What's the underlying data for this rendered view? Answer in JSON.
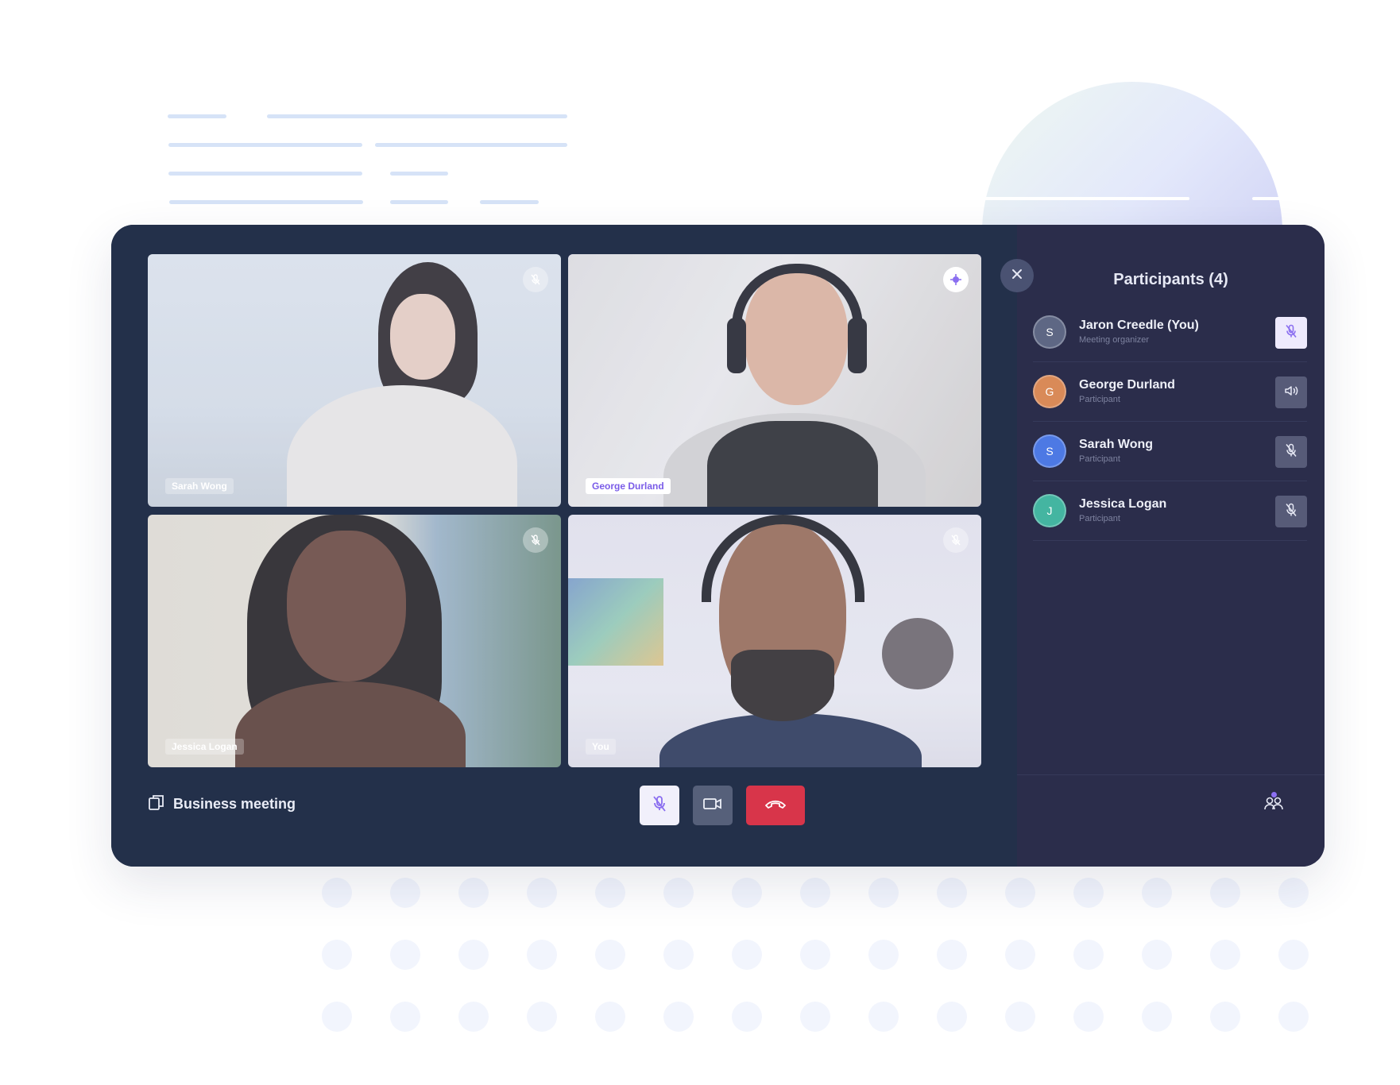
{
  "meeting": {
    "name": "Business meeting",
    "icon": "copy-icon"
  },
  "tiles": [
    {
      "name": "Sarah Wong",
      "mic": "mic-off-icon",
      "active": false
    },
    {
      "name": "George Durland",
      "mic": "speaking-icon",
      "active": true
    },
    {
      "name": "Jessica Logan",
      "mic": "mic-off-icon",
      "active": false
    },
    {
      "name": "You",
      "mic": "mic-off-icon",
      "active": false
    }
  ],
  "controls": {
    "mic": "mic-off-icon",
    "camera": "camera-icon",
    "end": "hang-up-icon"
  },
  "panel": {
    "title": "Participants (4)",
    "participants": [
      {
        "initial": "S",
        "name": "Jaron Creedle (You)",
        "role": "Meeting organizer",
        "color": "#5e6784",
        "action": "mic-off-icon"
      },
      {
        "initial": "G",
        "name": "George Durland",
        "role": "Participant",
        "color": "#d98a58",
        "action": "speaker-icon"
      },
      {
        "initial": "S",
        "name": "Sarah Wong",
        "role": "Participant",
        "color": "#4d79e4",
        "action": "mic-off-icon"
      },
      {
        "initial": "J",
        "name": "Jessica Logan",
        "role": "Participant",
        "color": "#44b5a1",
        "action": "mic-off-icon"
      }
    ]
  },
  "colors": {
    "accent": "#8a6ef0",
    "end_call": "#d8354a",
    "panel": "#2b2d4b",
    "stage": "#23304a"
  }
}
